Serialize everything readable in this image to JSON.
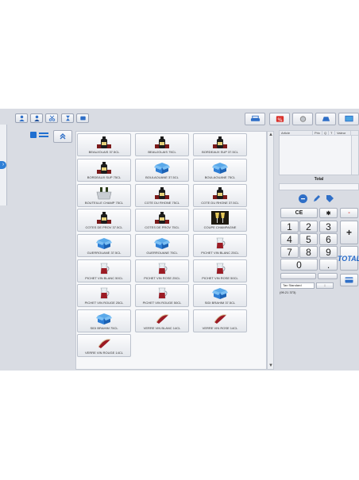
{
  "toolbar": {
    "left_icons": [
      "user-icon",
      "user-group-icon",
      "scissors-icon",
      "hourglass-icon",
      "message-icon"
    ],
    "right_icons": [
      "printer-icon",
      "percent-icon",
      "drawer-icon",
      "stamp-icon",
      "screen-icon"
    ]
  },
  "products": [
    {
      "label": "BEAUJOLAIS 37.5CL",
      "icon": "wine-bottle-icon"
    },
    {
      "label": "BEAUJOLAIS 75CL",
      "icon": "wine-bottle-icon"
    },
    {
      "label": "BORDEAUX SUP 37.5CL",
      "icon": "wine-bottle-icon"
    },
    {
      "label": "BORDEAUX SUP 75CL",
      "icon": "wine-bottle-icon"
    },
    {
      "label": "BOULAOUANE 37.5CL",
      "icon": "box-icon"
    },
    {
      "label": "BOULAOUANE 75CL",
      "icon": "box-icon"
    },
    {
      "label": "BOUTEILLE CHAMP 75CL",
      "icon": "champagne-bucket-icon"
    },
    {
      "label": "COTE DU RHONE 75CL",
      "icon": "wine-bottle-icon"
    },
    {
      "label": "COTE DU RHONE 37.5CL",
      "icon": "wine-bottle-icon"
    },
    {
      "label": "COTES DE PROV 37.5CL",
      "icon": "wine-bottle-icon"
    },
    {
      "label": "COTES DE PROV 75CL",
      "icon": "wine-bottle-icon"
    },
    {
      "label": "COUPE CHAMPAGNE",
      "icon": "champagne-glass-icon"
    },
    {
      "label": "GUERROUANE 37.5CL",
      "icon": "box-icon"
    },
    {
      "label": "GUERROUANE 75CL",
      "icon": "box-icon"
    },
    {
      "label": "PICHET VIN BLANC 25CL",
      "icon": "pitcher-icon"
    },
    {
      "label": "PICHET VIN BLANC 50CL",
      "icon": "pitcher-icon"
    },
    {
      "label": "PICHET VIN ROSE 25CL",
      "icon": "pitcher-icon"
    },
    {
      "label": "PICHET VIN ROSE 50CL",
      "icon": "pitcher-icon"
    },
    {
      "label": "PICHET VIN ROUGE 25CL",
      "icon": "pitcher-icon"
    },
    {
      "label": "PICHET VIN ROUGE 50CL",
      "icon": "pitcher-icon"
    },
    {
      "label": "SIDI BRAHIM 37.5CL",
      "icon": "box-icon"
    },
    {
      "label": "SIDI BRAHIM 75CL",
      "icon": "box-icon"
    },
    {
      "label": "VERRE VIN BLANC 14CL",
      "icon": "wine-glass-icon"
    },
    {
      "label": "VERRE VIN ROSE 14CL",
      "icon": "wine-glass-icon"
    },
    {
      "label": "VERRE VIN ROUGE 14CL",
      "icon": "wine-glass-icon"
    }
  ],
  "ticket": {
    "columns": [
      "Article",
      "Prix",
      "Q",
      "T",
      "Valeur"
    ],
    "total_label": "Total"
  },
  "keypad": {
    "ce": "CE",
    "star": "✱",
    "minus": "-",
    "plus": "+",
    "digits": [
      "1",
      "2",
      "3",
      "4",
      "5",
      "6",
      "7",
      "8",
      "9",
      "0",
      "."
    ],
    "total": "TOTAL"
  },
  "tax": {
    "selected": "Tax Standard",
    "button": "↓"
  },
  "code": "(99.21 373)",
  "colors": {
    "accent": "#2f7fd6",
    "danger": "#d9312b"
  }
}
